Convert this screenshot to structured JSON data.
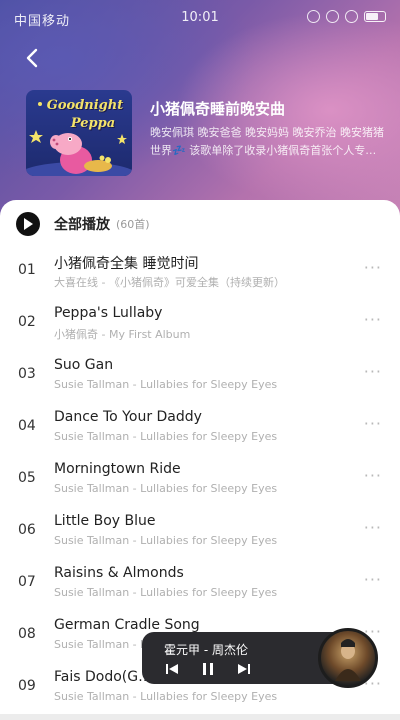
{
  "statusbar": {
    "carrier": "中国移动",
    "time": "10:01"
  },
  "header": {
    "back_icon": "chevron-left-icon"
  },
  "playlist": {
    "cover_line1": "Goodnight",
    "cover_line2": "Peppa",
    "title": "小猪佩奇睡前晚安曲",
    "description": "晚安佩琪 晚安爸爸 晚安妈妈 晚安乔治 晚安猪猪世界💤 该歌单除了收录小猪佩奇首张个人专辑《My First Album》的…"
  },
  "play_all": {
    "label": "全部播放",
    "count": "(60首)"
  },
  "tracks": [
    {
      "num": "01",
      "title": "小猪佩奇全集 睡觉时间",
      "sub": "大喜在线 - 《小猪佩奇》可爱全集（持续更新）"
    },
    {
      "num": "02",
      "title": "Peppa's Lullaby",
      "sub": "小猪佩奇 - My First Album"
    },
    {
      "num": "03",
      "title": "Suo Gan",
      "sub": "Susie Tallman - Lullabies for Sleepy Eyes"
    },
    {
      "num": "04",
      "title": "Dance To Your Daddy",
      "sub": "Susie Tallman - Lullabies for Sleepy Eyes"
    },
    {
      "num": "05",
      "title": "Morningtown Ride",
      "sub": "Susie Tallman - Lullabies for Sleepy Eyes"
    },
    {
      "num": "06",
      "title": "Little Boy Blue",
      "sub": "Susie Tallman - Lullabies for Sleepy Eyes"
    },
    {
      "num": "07",
      "title": "Raisins & Almonds",
      "sub": "Susie Tallman - Lullabies for Sleepy Eyes"
    },
    {
      "num": "08",
      "title": "German Cradle Song",
      "sub": "Susie Tallman - Lullabies for Sleepy Eyes"
    },
    {
      "num": "09",
      "title": "Fais Dodo(G…",
      "sub": "Susie Tallman - Lullabies for Sleepy Eyes"
    }
  ],
  "track_more_label": "···",
  "miniplayer": {
    "song": "霍元甲 - 周杰伦"
  }
}
